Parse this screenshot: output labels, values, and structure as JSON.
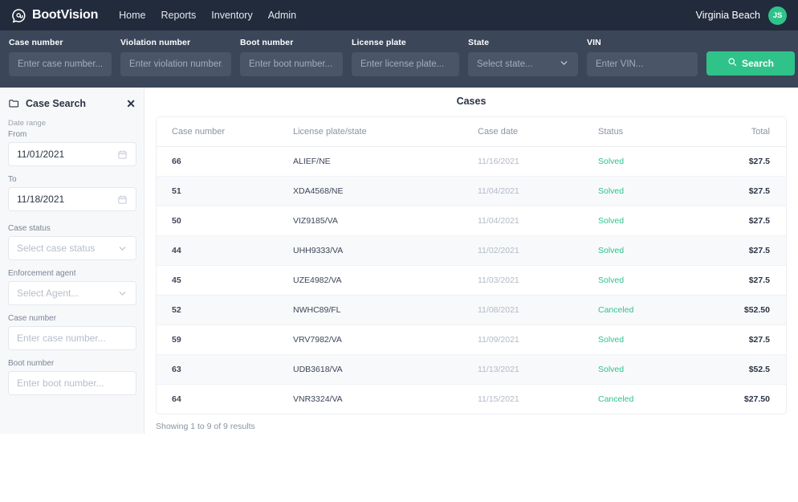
{
  "navbar": {
    "brand": "BootVision",
    "logo_icon": "at-speech-bubble-icon",
    "links": [
      {
        "label": "Home"
      },
      {
        "label": "Reports"
      },
      {
        "label": "Inventory"
      },
      {
        "label": "Admin"
      }
    ],
    "user_location": "Virginia Beach",
    "avatar_initials": "JS",
    "avatar_color": "#2fc38a"
  },
  "searchbar": {
    "background": "#3b4659",
    "fields": [
      {
        "label": "Case number",
        "placeholder": "Enter case number...",
        "value": ""
      },
      {
        "label": "Violation number",
        "placeholder": "Enter violation number..",
        "value": ""
      },
      {
        "label": "Boot number",
        "placeholder": "Enter boot number...",
        "value": ""
      },
      {
        "label": "License plate",
        "placeholder": "Enter license plate...",
        "value": ""
      },
      {
        "label": "State",
        "placeholder": "Select state...",
        "value": ""
      },
      {
        "label": "VIN",
        "placeholder": "Enter VIN...",
        "value": ""
      }
    ],
    "search_button": "Search",
    "search_button_color": "#2fc38a",
    "search_icon": "search-icon"
  },
  "sidebar": {
    "title": "Case Search",
    "folder_icon": "folder-icon",
    "close_icon": "close-icon",
    "date_range_label": "Date range",
    "from_label": "From",
    "from_value": "11/01/2021",
    "to_label": "To",
    "to_value": "11/18/2021",
    "calendar_icon": "calendar-icon",
    "case_status_label": "Case status",
    "case_status_value": "Select case status",
    "agent_label": "Enforcement agent",
    "agent_value": "Select Agent...",
    "case_number_label": "Case number",
    "case_number_placeholder": "Enter case number...",
    "boot_number_label": "Boot number",
    "boot_number_placeholder": "Enter boot number..."
  },
  "main": {
    "title": "Cases",
    "columns": [
      "Case number",
      "License plate/state",
      "Case date",
      "Status",
      "Total"
    ],
    "rows": [
      {
        "case_number": "66",
        "plate": "ALIEF/NE",
        "date": "11/16/2021",
        "status": "Solved",
        "total": "$27.5"
      },
      {
        "case_number": "51",
        "plate": "XDA4568/NE",
        "date": "11/04/2021",
        "status": "Solved",
        "total": "$27.5"
      },
      {
        "case_number": "50",
        "plate": "VIZ9185/VA",
        "date": "11/04/2021",
        "status": "Solved",
        "total": "$27.5"
      },
      {
        "case_number": "44",
        "plate": "UHH9333/VA",
        "date": "11/02/2021",
        "status": "Solved",
        "total": "$27.5"
      },
      {
        "case_number": "45",
        "plate": "UZE4982/VA",
        "date": "11/03/2021",
        "status": "Solved",
        "total": "$27.5"
      },
      {
        "case_number": "52",
        "plate": "NWHC89/FL",
        "date": "11/08/2021",
        "status": "Canceled",
        "total": "$52.50"
      },
      {
        "case_number": "59",
        "plate": "VRV7982/VA",
        "date": "11/09/2021",
        "status": "Solved",
        "total": "$27.5"
      },
      {
        "case_number": "63",
        "plate": "UDB3618/VA",
        "date": "11/13/2021",
        "status": "Solved",
        "total": "$52.5"
      },
      {
        "case_number": "64",
        "plate": "VNR3324/VA",
        "date": "11/15/2021",
        "status": "Canceled",
        "total": "$27.50"
      }
    ],
    "results_note": "Showing 1 to 9 of 9 results",
    "status_color": "#2fc38a"
  }
}
